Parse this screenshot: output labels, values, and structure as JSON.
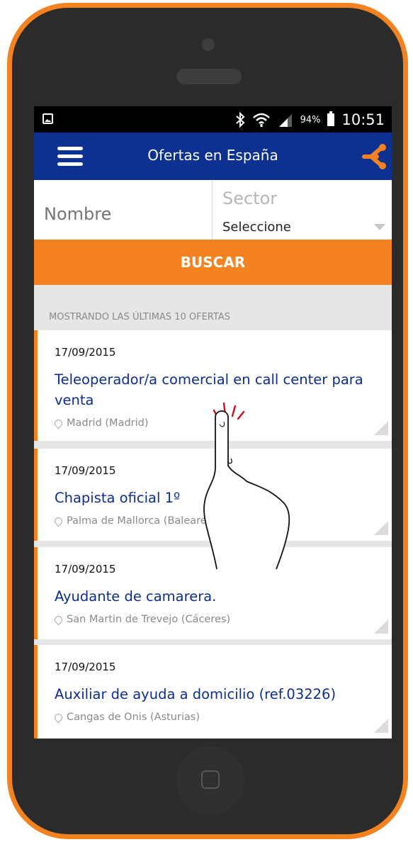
{
  "status_bar": {
    "bluetooth_icon": "bluetooth-icon",
    "wifi_icon": "wifi-icon",
    "signal_icon": "signal-icon",
    "battery_percent": "94%",
    "time": "10:51"
  },
  "top_bar": {
    "title": "Ofertas en España",
    "menu_icon": "hamburger-menu-icon",
    "brand_icon": "share-icon"
  },
  "search_form": {
    "name_placeholder": "Nombre",
    "sector_label": "Sector",
    "sector_selected": "Seleccione",
    "search_button": "BUSCAR"
  },
  "results": {
    "header": "MOSTRANDO LAS ÚLTIMAS 10 OFERTAS",
    "offers": [
      {
        "date": "17/09/2015",
        "title": "Teleoperador/a comercial en call center para venta",
        "location": "Madrid (Madrid)"
      },
      {
        "date": "17/09/2015",
        "title": "Chapista oficial 1º",
        "location": "Palma de Mallorca (Baleares)"
      },
      {
        "date": "17/09/2015",
        "title": "Ayudante de camarera.",
        "location": "San Martin de Trevejo (Cáceres)"
      },
      {
        "date": "17/09/2015",
        "title": "Auxiliar de ayuda a domicilio (ref.03226)",
        "location": "Cangas de Onis (Asturias)"
      }
    ]
  },
  "colors": {
    "accent": "#f58220",
    "header_blue": "#0d3190",
    "link_blue": "#0d2e8f"
  }
}
